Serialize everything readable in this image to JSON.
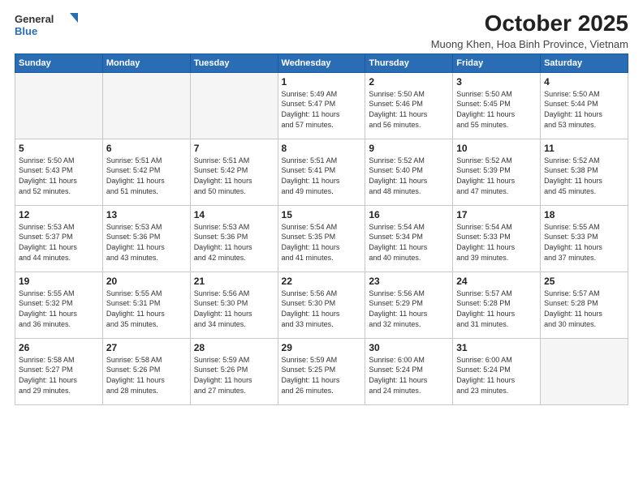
{
  "header": {
    "logo_general": "General",
    "logo_blue": "Blue",
    "month_title": "October 2025",
    "location": "Muong Khen, Hoa Binh Province, Vietnam"
  },
  "weekdays": [
    "Sunday",
    "Monday",
    "Tuesday",
    "Wednesday",
    "Thursday",
    "Friday",
    "Saturday"
  ],
  "weeks": [
    [
      {
        "day": "",
        "info": ""
      },
      {
        "day": "",
        "info": ""
      },
      {
        "day": "",
        "info": ""
      },
      {
        "day": "1",
        "info": "Sunrise: 5:49 AM\nSunset: 5:47 PM\nDaylight: 11 hours\nand 57 minutes."
      },
      {
        "day": "2",
        "info": "Sunrise: 5:50 AM\nSunset: 5:46 PM\nDaylight: 11 hours\nand 56 minutes."
      },
      {
        "day": "3",
        "info": "Sunrise: 5:50 AM\nSunset: 5:45 PM\nDaylight: 11 hours\nand 55 minutes."
      },
      {
        "day": "4",
        "info": "Sunrise: 5:50 AM\nSunset: 5:44 PM\nDaylight: 11 hours\nand 53 minutes."
      }
    ],
    [
      {
        "day": "5",
        "info": "Sunrise: 5:50 AM\nSunset: 5:43 PM\nDaylight: 11 hours\nand 52 minutes."
      },
      {
        "day": "6",
        "info": "Sunrise: 5:51 AM\nSunset: 5:42 PM\nDaylight: 11 hours\nand 51 minutes."
      },
      {
        "day": "7",
        "info": "Sunrise: 5:51 AM\nSunset: 5:42 PM\nDaylight: 11 hours\nand 50 minutes."
      },
      {
        "day": "8",
        "info": "Sunrise: 5:51 AM\nSunset: 5:41 PM\nDaylight: 11 hours\nand 49 minutes."
      },
      {
        "day": "9",
        "info": "Sunrise: 5:52 AM\nSunset: 5:40 PM\nDaylight: 11 hours\nand 48 minutes."
      },
      {
        "day": "10",
        "info": "Sunrise: 5:52 AM\nSunset: 5:39 PM\nDaylight: 11 hours\nand 47 minutes."
      },
      {
        "day": "11",
        "info": "Sunrise: 5:52 AM\nSunset: 5:38 PM\nDaylight: 11 hours\nand 45 minutes."
      }
    ],
    [
      {
        "day": "12",
        "info": "Sunrise: 5:53 AM\nSunset: 5:37 PM\nDaylight: 11 hours\nand 44 minutes."
      },
      {
        "day": "13",
        "info": "Sunrise: 5:53 AM\nSunset: 5:36 PM\nDaylight: 11 hours\nand 43 minutes."
      },
      {
        "day": "14",
        "info": "Sunrise: 5:53 AM\nSunset: 5:36 PM\nDaylight: 11 hours\nand 42 minutes."
      },
      {
        "day": "15",
        "info": "Sunrise: 5:54 AM\nSunset: 5:35 PM\nDaylight: 11 hours\nand 41 minutes."
      },
      {
        "day": "16",
        "info": "Sunrise: 5:54 AM\nSunset: 5:34 PM\nDaylight: 11 hours\nand 40 minutes."
      },
      {
        "day": "17",
        "info": "Sunrise: 5:54 AM\nSunset: 5:33 PM\nDaylight: 11 hours\nand 39 minutes."
      },
      {
        "day": "18",
        "info": "Sunrise: 5:55 AM\nSunset: 5:33 PM\nDaylight: 11 hours\nand 37 minutes."
      }
    ],
    [
      {
        "day": "19",
        "info": "Sunrise: 5:55 AM\nSunset: 5:32 PM\nDaylight: 11 hours\nand 36 minutes."
      },
      {
        "day": "20",
        "info": "Sunrise: 5:55 AM\nSunset: 5:31 PM\nDaylight: 11 hours\nand 35 minutes."
      },
      {
        "day": "21",
        "info": "Sunrise: 5:56 AM\nSunset: 5:30 PM\nDaylight: 11 hours\nand 34 minutes."
      },
      {
        "day": "22",
        "info": "Sunrise: 5:56 AM\nSunset: 5:30 PM\nDaylight: 11 hours\nand 33 minutes."
      },
      {
        "day": "23",
        "info": "Sunrise: 5:56 AM\nSunset: 5:29 PM\nDaylight: 11 hours\nand 32 minutes."
      },
      {
        "day": "24",
        "info": "Sunrise: 5:57 AM\nSunset: 5:28 PM\nDaylight: 11 hours\nand 31 minutes."
      },
      {
        "day": "25",
        "info": "Sunrise: 5:57 AM\nSunset: 5:28 PM\nDaylight: 11 hours\nand 30 minutes."
      }
    ],
    [
      {
        "day": "26",
        "info": "Sunrise: 5:58 AM\nSunset: 5:27 PM\nDaylight: 11 hours\nand 29 minutes."
      },
      {
        "day": "27",
        "info": "Sunrise: 5:58 AM\nSunset: 5:26 PM\nDaylight: 11 hours\nand 28 minutes."
      },
      {
        "day": "28",
        "info": "Sunrise: 5:59 AM\nSunset: 5:26 PM\nDaylight: 11 hours\nand 27 minutes."
      },
      {
        "day": "29",
        "info": "Sunrise: 5:59 AM\nSunset: 5:25 PM\nDaylight: 11 hours\nand 26 minutes."
      },
      {
        "day": "30",
        "info": "Sunrise: 6:00 AM\nSunset: 5:24 PM\nDaylight: 11 hours\nand 24 minutes."
      },
      {
        "day": "31",
        "info": "Sunrise: 6:00 AM\nSunset: 5:24 PM\nDaylight: 11 hours\nand 23 minutes."
      },
      {
        "day": "",
        "info": ""
      }
    ]
  ]
}
